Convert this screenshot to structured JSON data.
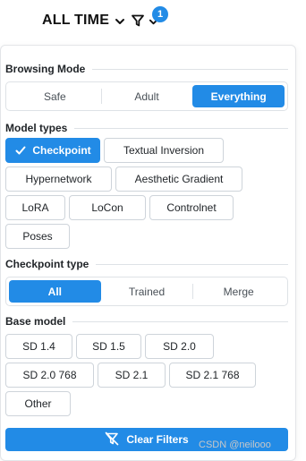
{
  "header": {
    "sort_label": "ALL TIME",
    "filter_badge": "1"
  },
  "browsing_mode": {
    "title": "Browsing Mode",
    "options": [
      "Safe",
      "Adult",
      "Everything"
    ],
    "selected": "Everything"
  },
  "model_types": {
    "title": "Model types",
    "options": [
      "Checkpoint",
      "Textual Inversion",
      "Hypernetwork",
      "Aesthetic Gradient",
      "LoRA",
      "LoCon",
      "Controlnet",
      "Poses"
    ],
    "selected": "Checkpoint"
  },
  "checkpoint_type": {
    "title": "Checkpoint type",
    "options": [
      "All",
      "Trained",
      "Merge"
    ],
    "selected": "All"
  },
  "base_model": {
    "title": "Base model",
    "options": [
      "SD 1.4",
      "SD 1.5",
      "SD 2.0",
      "SD 2.0 768",
      "SD 2.1",
      "SD 2.1 768",
      "Other"
    ]
  },
  "actions": {
    "clear_filters": "Clear Filters"
  },
  "watermark": "CSDN @neilooo",
  "colors": {
    "accent": "#228be6",
    "border": "#ced4da"
  },
  "icons": {
    "sort": "chevron-down-icon",
    "filter": "filter-icon",
    "check": "check-icon",
    "clear": "filter-off-icon"
  }
}
